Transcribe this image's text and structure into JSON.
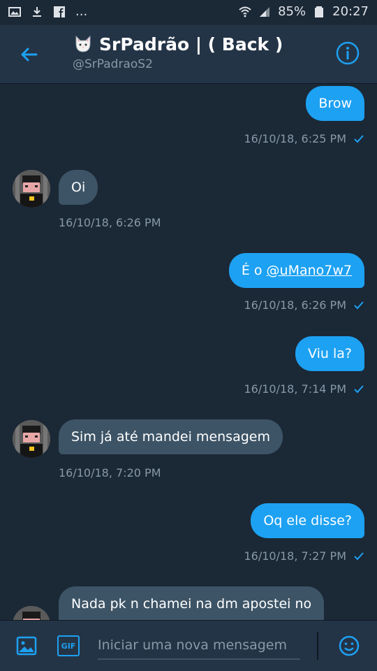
{
  "status_bar": {
    "battery": "85%",
    "time": "20:27",
    "notif_more": "..."
  },
  "header": {
    "title": "SrPadrão | ( Back )",
    "handle": "@SrPadraoS2"
  },
  "messages": [
    {
      "dir": "out",
      "text": "Brow",
      "time": "16/10/18, 6:25 PM"
    },
    {
      "dir": "in",
      "text": "Oi",
      "time": "16/10/18, 6:26 PM"
    },
    {
      "dir": "out",
      "prefix": "É o ",
      "mention": "@uMano7w7",
      "time": "16/10/18, 6:26 PM"
    },
    {
      "dir": "out",
      "text": "Viu la?",
      "time": "16/10/18, 7:14 PM"
    },
    {
      "dir": "in",
      "text": "Sim  já até mandei mensagem",
      "time": "16/10/18, 7:20 PM"
    },
    {
      "dir": "out",
      "text": "Oq ele disse?",
      "time": "16/10/18, 7:27 PM"
    },
    {
      "dir": "in",
      "text": "Nada pk n chamei na dm apostei no"
    }
  ],
  "composer": {
    "placeholder": "Iniciar uma nova mensagem",
    "gif_label": "GIF"
  },
  "colors": {
    "background": "#1b2836",
    "header": "#243447",
    "accent": "#1da1f2",
    "incoming_bubble": "#3d5466",
    "muted_text": "#8899a6"
  }
}
